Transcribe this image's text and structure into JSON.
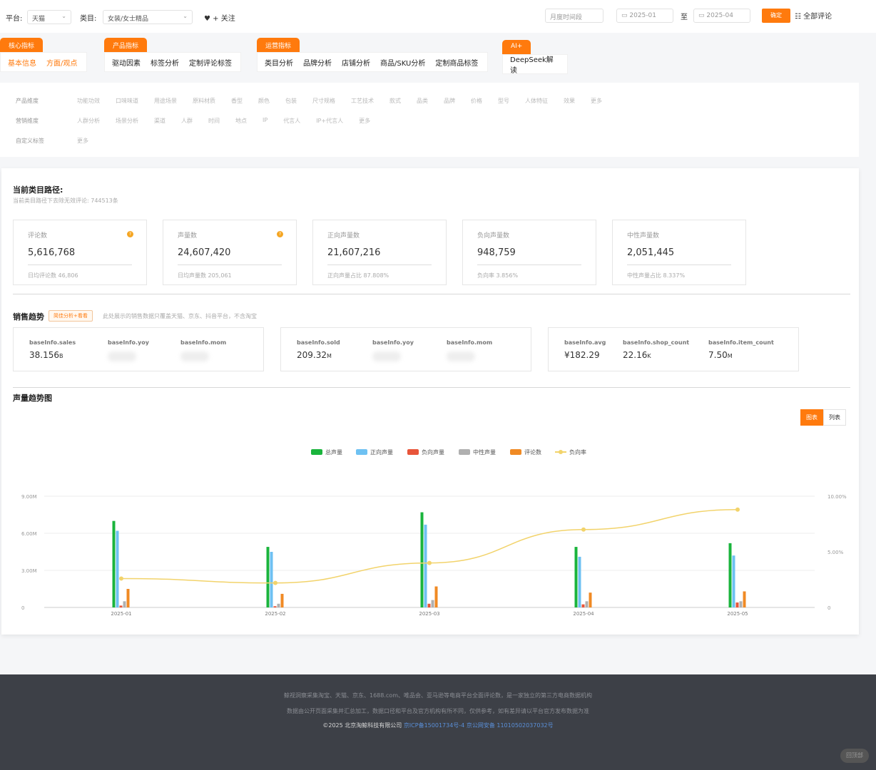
{
  "topbar": {
    "platform_label": "平台:",
    "platform_value": "天猫",
    "category_label": "类目:",
    "category_value": "女装/女士精品",
    "follow_label": "♥ + 关注",
    "time_select": "月度时间段",
    "date_start": "2025-01",
    "date_sep": "至",
    "date_end": "2025-04",
    "confirm": "确定",
    "all_comments": "全部评论"
  },
  "tab_groups": [
    {
      "head": "核心指标",
      "items": [
        "基本信息",
        "方面/观点"
      ]
    },
    {
      "head": "产品指标",
      "items": [
        "驱动因素",
        "标签分析",
        "定制评论标签"
      ]
    },
    {
      "head": "运营指标",
      "items": [
        "类目分析",
        "品牌分析",
        "店铺分析",
        "商品/SKU分析",
        "定制商品标签"
      ]
    },
    {
      "head": "AI+",
      "items": [
        "DeepSeek解读"
      ]
    }
  ],
  "tag_rows": [
    {
      "head": "产品维度",
      "items": [
        "功能功效",
        "口味味道",
        "用途场景",
        "原料材质",
        "香型",
        "颜色",
        "包装",
        "尺寸规格",
        "工艺技术",
        "款式",
        "品类",
        "品牌",
        "价格",
        "型号",
        "人体特征",
        "效果",
        "更多"
      ]
    },
    {
      "head": "营销维度",
      "items": [
        "人群分析",
        "场景分析",
        "渠道",
        "人群",
        "时间",
        "地点",
        "IP",
        "代言人",
        "IP+代言人",
        "更多"
      ]
    },
    {
      "head": "自定义标签",
      "items": [
        "更多"
      ]
    }
  ],
  "main": {
    "path_title": "当前类目路径:",
    "path_sub": "当前类目路径下去除无效评论: 744513条",
    "cards": [
      {
        "label": "评论数",
        "value": "5,616,768",
        "foot": "日均评论数  46,806",
        "q": true
      },
      {
        "label": "声量数",
        "value": "24,607,420",
        "foot": "日均声量数  205,061",
        "q": true
      },
      {
        "label": "正向声量数",
        "value": "21,607,216",
        "foot": "正向声量占比  87.808%",
        "q": false
      },
      {
        "label": "负向声量数",
        "value": "948,759",
        "foot": "负向率  3.856%",
        "q": false
      },
      {
        "label": "中性声量数",
        "value": "2,051,445",
        "foot": "中性声量占比  8.337%",
        "q": false
      }
    ],
    "sales_title": "销售趋势",
    "sales_badge": "简佳分析+看看",
    "sales_note": "此处展示的销售数据只覆盖天猫、京东、抖音平台，不含淘宝",
    "sales_cards": [
      [
        {
          "k": "baseInfo.sales",
          "v": "38.156",
          "u": "B"
        },
        {
          "k": "baseInfo.yoy",
          "v": ""
        },
        {
          "k": "baseInfo.mom",
          "v": ""
        }
      ],
      [
        {
          "k": "baseInfo.sold",
          "v": "209.32",
          "u": "M"
        },
        {
          "k": "baseInfo.yoy",
          "v": ""
        },
        {
          "k": "baseInfo.mom",
          "v": ""
        }
      ],
      [
        {
          "k": "baseInfo.avg",
          "v": "¥182.29",
          "u": ""
        },
        {
          "k": "baseInfo.shop_count",
          "v": "22.16",
          "u": "K"
        },
        {
          "k": "baseInfo.item_count",
          "v": "7.50",
          "u": "M"
        }
      ]
    ],
    "chart_title": "声量趋势图",
    "view_chart": "图表",
    "view_list": "列表"
  },
  "chart_data": {
    "type": "bar",
    "categories": [
      "2025-01",
      "2025-02",
      "2025-03",
      "2025-04",
      "2025-05"
    ],
    "series": [
      {
        "name": "总声量",
        "color": "#1ab43c",
        "values": [
          7.0,
          4.9,
          7.7,
          4.9,
          5.2
        ]
      },
      {
        "name": "正向声量",
        "color": "#6ec1f2",
        "values": [
          6.2,
          4.5,
          6.7,
          4.1,
          4.2
        ]
      },
      {
        "name": "负向声量",
        "color": "#e8553a",
        "values": [
          0.15,
          0.1,
          0.3,
          0.25,
          0.4
        ]
      },
      {
        "name": "中性声量",
        "color": "#b0b0b0",
        "values": [
          0.5,
          0.3,
          0.6,
          0.5,
          0.5
        ]
      },
      {
        "name": "评论数",
        "color": "#f08a24",
        "values": [
          1.5,
          1.1,
          1.7,
          1.2,
          1.3
        ]
      }
    ],
    "line_series": {
      "name": "负向率",
      "color": "#f2d36b",
      "values": [
        2.6,
        2.2,
        4.0,
        7.0,
        8.8
      ]
    },
    "y_left": {
      "ticks": [
        "0",
        "3.00M",
        "6.00M",
        "9.00M"
      ],
      "min": 0,
      "max": 9
    },
    "y_right": {
      "ticks": [
        "0",
        "5.00%",
        "10.00%"
      ],
      "min": 0,
      "max": 10
    },
    "legend_position": "top-center",
    "grid": true
  },
  "footer": {
    "line1": "鲸视洞察采集淘宝、天猫、京东、1688.com、唯品会、亚马逊等电商平台全面评论数，是一家独立的第三方电商数据机构",
    "line2": "数据由公开页面采集并汇总加工，数据口径和平台及官方机构有所不同，仅供参考，如有差异请以平台官方发布数据为准",
    "copyright": "©2025 北京淘鲸科技有限公司",
    "icp": "京ICP备15001734号-4",
    "police": "京公网安备 11010502037032号",
    "float_btn": "回顶部"
  }
}
